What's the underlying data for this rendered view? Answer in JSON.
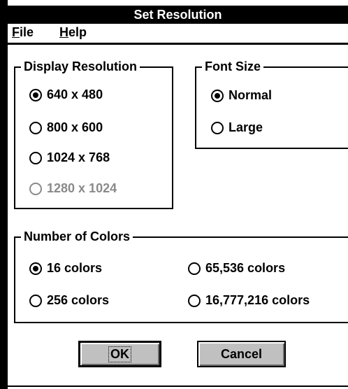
{
  "window": {
    "title": "Set Resolution"
  },
  "menu": {
    "file": {
      "accel": "F",
      "rest": "ile"
    },
    "help": {
      "accel": "H",
      "rest": "elp"
    }
  },
  "display_resolution": {
    "title": "Display Resolution",
    "options": [
      {
        "label": "640 x 480",
        "selected": true,
        "enabled": true
      },
      {
        "label": "800 x 600",
        "selected": false,
        "enabled": true
      },
      {
        "label": "1024 x 768",
        "selected": false,
        "enabled": true
      },
      {
        "label": "1280 x 1024",
        "selected": false,
        "enabled": false
      }
    ]
  },
  "font_size": {
    "title": "Font Size",
    "options": [
      {
        "label": "Normal",
        "selected": true
      },
      {
        "label": "Large",
        "selected": false
      }
    ]
  },
  "colors": {
    "title": "Number of Colors",
    "options": [
      {
        "label": "16 colors",
        "selected": true
      },
      {
        "label": "65,536 colors",
        "selected": false
      },
      {
        "label": "256 colors",
        "selected": false
      },
      {
        "label": "16,777,216 colors",
        "selected": false
      }
    ]
  },
  "buttons": {
    "ok": "OK",
    "cancel": "Cancel"
  },
  "palette": {
    "titlebar": "#000000",
    "button_face": "#c0c0c0",
    "disabled_text": "#8a8a8a"
  }
}
